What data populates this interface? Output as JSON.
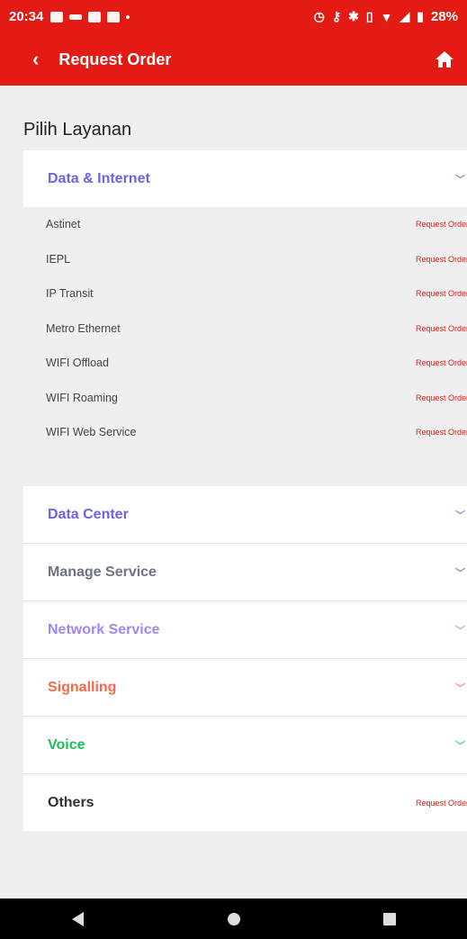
{
  "status_bar": {
    "time": "20:34",
    "battery": "28%"
  },
  "app_bar": {
    "back_icon": "‹",
    "title": "Request Order",
    "home_icon": "home-icon"
  },
  "section_title": "Pilih Layanan",
  "colors": {
    "brand_red": "#e31b14",
    "data_internet": "#6a63e3",
    "data_center": "#6a63e3",
    "manage_service": "#6e7384",
    "network_service": "#9f86f0",
    "signalling": "#f36a4c",
    "voice": "#17c05a",
    "others": "#333333"
  },
  "categories": [
    {
      "label": "Data & Internet",
      "expanded": true
    },
    {
      "label": "Data Center"
    },
    {
      "label": "Manage Service"
    },
    {
      "label": "Network Service"
    },
    {
      "label": "Signalling"
    },
    {
      "label": "Voice"
    },
    {
      "label": "Others",
      "action": "Request Order"
    }
  ],
  "data_internet_items": [
    {
      "label": "Astinet",
      "action": "Request Order"
    },
    {
      "label": "IEPL",
      "action": "Request Order"
    },
    {
      "label": "IP Transit",
      "action": "Request Order"
    },
    {
      "label": "Metro Ethernet",
      "action": "Request Order"
    },
    {
      "label": "WIFI Offload",
      "action": "Request Order"
    },
    {
      "label": "WIFI Roaming",
      "action": "Request Order"
    },
    {
      "label": "WIFI Web Service",
      "action": "Request Order"
    }
  ]
}
